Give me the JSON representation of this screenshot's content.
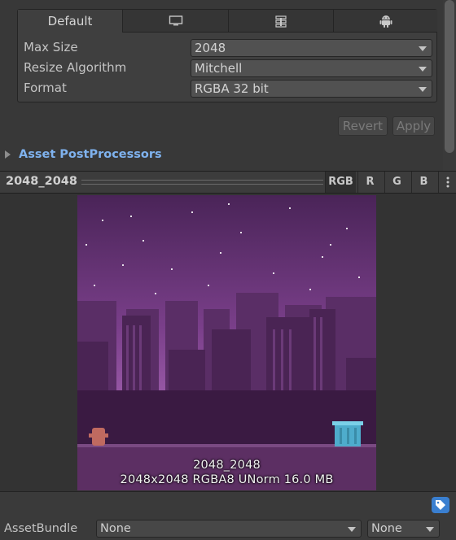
{
  "platform_tabs": [
    {
      "label": "Default",
      "icon": null
    },
    {
      "label": "",
      "icon": "monitor-icon"
    },
    {
      "label": "",
      "icon": "server-icon"
    },
    {
      "label": "",
      "icon": "android-icon"
    }
  ],
  "settings": {
    "max_size_label": "Max Size",
    "max_size_value": "2048",
    "resize_label": "Resize Algorithm",
    "resize_value": "Mitchell",
    "format_label": "Format",
    "format_value": "RGBA 32 bit"
  },
  "buttons": {
    "revert": "Revert",
    "apply": "Apply"
  },
  "postprocessors_label": "Asset PostProcessors",
  "preview": {
    "title": "2048_2048",
    "channels": [
      "RGB",
      "R",
      "G",
      "B"
    ],
    "overlay_name": "2048_2048",
    "overlay_info": "2048x2048  RGBA8 UNorm   16.0 MB"
  },
  "asset_bundle": {
    "label": "AssetBundle",
    "name_value": "None",
    "variant_value": "None"
  },
  "colors": {
    "link": "#7fb2ee",
    "accent_tag": "#3a7fd0"
  }
}
